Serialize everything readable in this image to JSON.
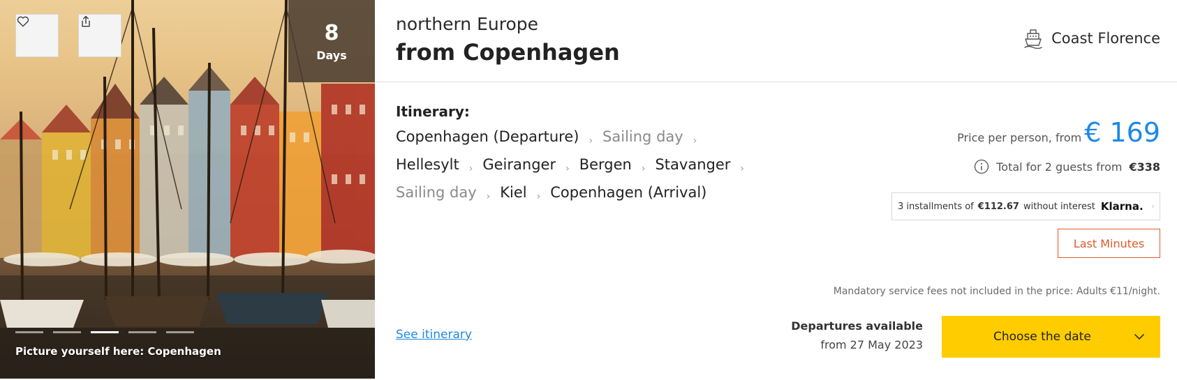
{
  "photo": {
    "days_number": "8",
    "days_label": "Days",
    "caption": "Picture yourself here: Copenhagen",
    "slide_count": 5,
    "active_slide": 3
  },
  "header": {
    "destination": "northern Europe",
    "from": "from Copenhagen",
    "ship_name": "Coast Florence"
  },
  "itinerary": {
    "title": "Itinerary:",
    "stops": [
      {
        "label": "Copenhagen (Departure)",
        "type": "port"
      },
      {
        "label": "Sailing day",
        "type": "sailing"
      },
      {
        "label": "Hellesylt",
        "type": "port"
      },
      {
        "label": "Geiranger",
        "type": "port"
      },
      {
        "label": "Bergen",
        "type": "port"
      },
      {
        "label": "Stavanger",
        "type": "port"
      },
      {
        "label": "Sailing day",
        "type": "sailing"
      },
      {
        "label": "Kiel",
        "type": "port"
      },
      {
        "label": "Copenhagen (Arrival)",
        "type": "port"
      }
    ],
    "separator": "›",
    "see_link": "See itinerary"
  },
  "pricing": {
    "per_person_label": "Price per person, from",
    "price": "€ 169",
    "total_label": "Total for 2 guests from",
    "total_value": "€338",
    "klarna_prefix": "3 installments of",
    "klarna_amount": "€112.67",
    "klarna_suffix": "without interest",
    "klarna_brand": "Klarna.",
    "badge": "Last Minutes",
    "fees_note": "Mandatory service fees not included in the price: Adults €11/night."
  },
  "departures": {
    "title": "Departures available",
    "from_date": "from 27 May 2023",
    "cta": "Choose the date"
  },
  "colors": {
    "accent_blue": "#1e88e5",
    "cta_yellow": "#ffcc00",
    "badge_orange": "#e05a2b"
  },
  "icons": [
    "heart-icon",
    "share-icon",
    "ship-icon",
    "info-icon",
    "chevron-down-icon",
    "chevron-right-icon"
  ]
}
